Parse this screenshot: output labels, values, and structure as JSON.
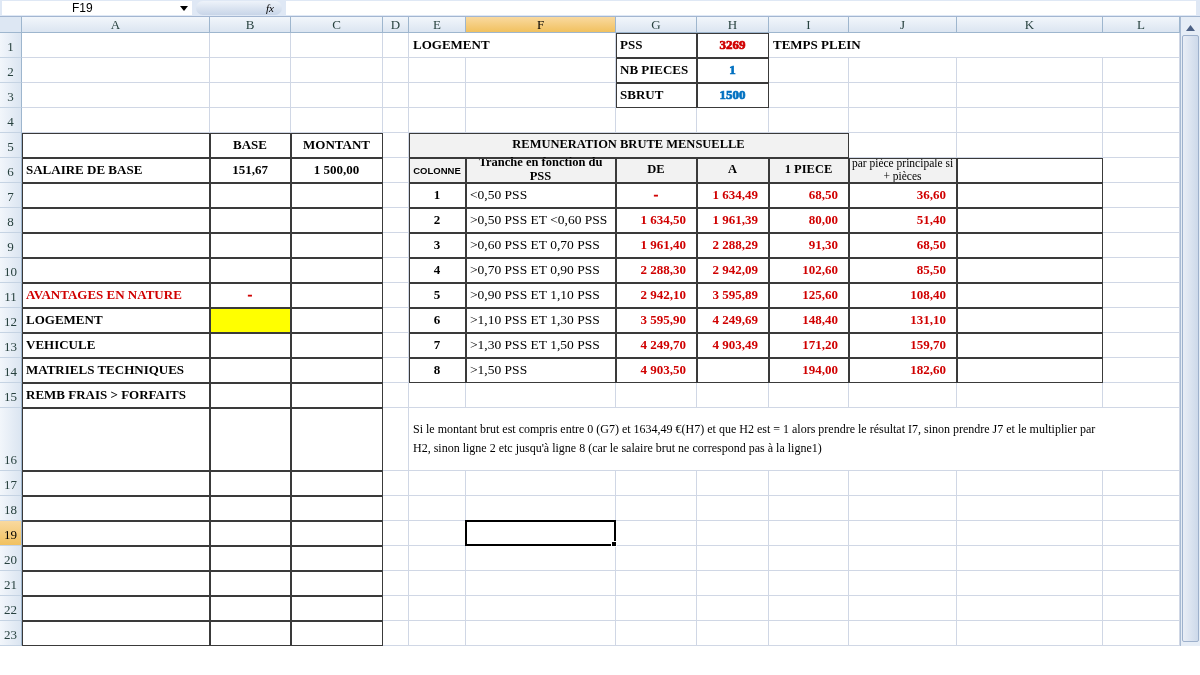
{
  "formula_bar": {
    "name_box": "F19",
    "function_label": "fx"
  },
  "columns": [
    {
      "label": "A",
      "selected": false
    },
    {
      "label": "B",
      "selected": false
    },
    {
      "label": "C",
      "selected": false
    },
    {
      "label": "D",
      "selected": false
    },
    {
      "label": "E",
      "selected": false
    },
    {
      "label": "F",
      "selected": true
    },
    {
      "label": "G",
      "selected": false
    },
    {
      "label": "H",
      "selected": false
    },
    {
      "label": "I",
      "selected": false
    },
    {
      "label": "J",
      "selected": false
    },
    {
      "label": "K",
      "selected": false
    },
    {
      "label": "L",
      "selected": false
    }
  ],
  "rows": [
    {
      "label": "1",
      "selected": false,
      "cells": {
        "E": {
          "kind": "label",
          "text": "LOGEMENT"
        },
        "G": {
          "kind": "label",
          "text": "PSS"
        },
        "H": {
          "kind": "center",
          "text": "3269",
          "color": "#d00000"
        },
        "I": {
          "kind": "label",
          "text": "TEMPS PLEIN"
        }
      }
    },
    {
      "label": "2",
      "selected": false,
      "cells": {
        "G": {
          "kind": "label",
          "text": "NB PIECES"
        },
        "H": {
          "kind": "center",
          "text": "1",
          "color": "#0070c0"
        }
      }
    },
    {
      "label": "3",
      "selected": false,
      "cells": {
        "G": {
          "kind": "label",
          "text": "SBRUT"
        },
        "H": {
          "kind": "center",
          "text": "1500",
          "color": "#0070c0"
        }
      }
    },
    {
      "label": "4",
      "selected": false,
      "cells": {}
    },
    {
      "label": "5",
      "selected": false,
      "cells": {
        "B": {
          "kind": "center",
          "text": "BASE"
        },
        "C": {
          "kind": "center",
          "text": "MONTANT"
        },
        "E": {
          "kind": "title",
          "text": "REMUNERATION BRUTE MENSUELLE"
        }
      }
    },
    {
      "label": "6",
      "selected": false,
      "cells": {
        "A": {
          "kind": "label",
          "text": "SALAIRE DE BASE"
        },
        "B": {
          "kind": "center",
          "text": "151,67"
        },
        "C": {
          "kind": "center",
          "text": "1 500,00"
        },
        "E": {
          "kind": "header-small",
          "text": "COLONNE"
        },
        "F": {
          "kind": "header",
          "text": "Tranche en fonction du PSS"
        },
        "G": {
          "kind": "header",
          "text": "DE"
        },
        "H": {
          "kind": "header",
          "text": "A"
        },
        "I": {
          "kind": "header",
          "text": "1 PIECE"
        },
        "J": {
          "kind": "header-plain",
          "text": "par pièce principale si + pièces"
        }
      }
    },
    {
      "label": "7",
      "selected": false,
      "cells": {
        "E": {
          "kind": "center",
          "text": "1"
        },
        "F": {
          "kind": "plain",
          "text": "<0,50 PSS"
        },
        "G": {
          "kind": "center",
          "text": "-",
          "color": "#d00000"
        },
        "H": {
          "kind": "right",
          "text": "1 634,49",
          "color": "#d00000"
        },
        "I": {
          "kind": "right",
          "text": "68,50",
          "color": "#d00000"
        },
        "J": {
          "kind": "right",
          "text": "36,60",
          "color": "#d00000"
        }
      }
    },
    {
      "label": "8",
      "selected": false,
      "cells": {
        "E": {
          "kind": "center",
          "text": "2"
        },
        "F": {
          "kind": "plain",
          "text": ">0,50 PSS ET <0,60 PSS"
        },
        "G": {
          "kind": "right",
          "text": "1 634,50",
          "color": "#d00000"
        },
        "H": {
          "kind": "right",
          "text": "1 961,39",
          "color": "#d00000"
        },
        "I": {
          "kind": "right",
          "text": "80,00",
          "color": "#d00000"
        },
        "J": {
          "kind": "right",
          "text": "51,40",
          "color": "#d00000"
        }
      }
    },
    {
      "label": "9",
      "selected": false,
      "cells": {
        "E": {
          "kind": "center",
          "text": "3"
        },
        "F": {
          "kind": "plain",
          "text": ">0,60 PSS ET 0,70 PSS"
        },
        "G": {
          "kind": "right",
          "text": "1 961,40",
          "color": "#d00000"
        },
        "H": {
          "kind": "right",
          "text": "2 288,29",
          "color": "#d00000"
        },
        "I": {
          "kind": "right",
          "text": "91,30",
          "color": "#d00000"
        },
        "J": {
          "kind": "right",
          "text": "68,50",
          "color": "#d00000"
        }
      }
    },
    {
      "label": "10",
      "selected": false,
      "cells": {
        "E": {
          "kind": "center",
          "text": "4"
        },
        "F": {
          "kind": "plain",
          "text": ">0,70 PSS ET 0,90 PSS"
        },
        "G": {
          "kind": "right",
          "text": "2 288,30",
          "color": "#d00000"
        },
        "H": {
          "kind": "right",
          "text": "2 942,09",
          "color": "#d00000"
        },
        "I": {
          "kind": "right",
          "text": "102,60",
          "color": "#d00000"
        },
        "J": {
          "kind": "right",
          "text": "85,50",
          "color": "#d00000"
        }
      }
    },
    {
      "label": "11",
      "selected": false,
      "cells": {
        "A": {
          "kind": "label",
          "text": "AVANTAGES EN NATURE",
          "color": "#d00000"
        },
        "B": {
          "kind": "center",
          "text": "-",
          "color": "#d00000"
        },
        "E": {
          "kind": "center",
          "text": "5"
        },
        "F": {
          "kind": "plain",
          "text": " >0,90 PSS ET 1,10 PSS"
        },
        "G": {
          "kind": "right",
          "text": "2 942,10",
          "color": "#d00000"
        },
        "H": {
          "kind": "right",
          "text": "3 595,89",
          "color": "#d00000"
        },
        "I": {
          "kind": "right",
          "text": "125,60",
          "color": "#d00000"
        },
        "J": {
          "kind": "right",
          "text": "108,40",
          "color": "#d00000"
        }
      }
    },
    {
      "label": "12",
      "selected": false,
      "cells": {
        "A": {
          "kind": "label",
          "text": "LOGEMENT"
        },
        "B": {
          "kind": "highlight"
        },
        "E": {
          "kind": "center",
          "text": "6"
        },
        "F": {
          "kind": "plain",
          "text": ">1,10 PSS ET 1,30 PSS"
        },
        "G": {
          "kind": "right",
          "text": "3 595,90",
          "color": "#d00000"
        },
        "H": {
          "kind": "right",
          "text": "4 249,69",
          "color": "#d00000"
        },
        "I": {
          "kind": "right",
          "text": "148,40",
          "color": "#d00000"
        },
        "J": {
          "kind": "right",
          "text": "131,10",
          "color": "#d00000"
        }
      }
    },
    {
      "label": "13",
      "selected": false,
      "cells": {
        "A": {
          "kind": "label",
          "text": "VEHICULE"
        },
        "E": {
          "kind": "center",
          "text": "7"
        },
        "F": {
          "kind": "plain",
          "text": ">1,30 PSS ET 1,50 PSS"
        },
        "G": {
          "kind": "right",
          "text": "4 249,70",
          "color": "#d00000"
        },
        "H": {
          "kind": "right",
          "text": "4 903,49",
          "color": "#d00000"
        },
        "I": {
          "kind": "right",
          "text": "171,20",
          "color": "#d00000"
        },
        "J": {
          "kind": "right",
          "text": "159,70",
          "color": "#d00000"
        }
      }
    },
    {
      "label": "14",
      "selected": false,
      "cells": {
        "A": {
          "kind": "label",
          "text": "MATRIELS TECHNIQUES"
        },
        "E": {
          "kind": "center",
          "text": "8"
        },
        "F": {
          "kind": "plain",
          "text": ">1,50 PSS"
        },
        "G": {
          "kind": "right",
          "text": "4 903,50",
          "color": "#d00000"
        },
        "I": {
          "kind": "right",
          "text": "194,00",
          "color": "#d00000"
        },
        "J": {
          "kind": "right",
          "text": "182,60",
          "color": "#d00000"
        }
      }
    },
    {
      "label": "15",
      "selected": false,
      "cells": {
        "A": {
          "kind": "label",
          "text": "REMB FRAIS > FORFAITS"
        }
      }
    },
    {
      "label": "16",
      "selected": false,
      "cells": {
        "E": {
          "kind": "note",
          "text": "Si le montant brut est compris entre 0 (G7) et 1634,49 €(H7)  et que H2 est = 1 alors prendre le résultat I7, sinon prendre J7 et le multiplier par H2, sinon ligne 2 etc jusqu'à ligne 8 (car le salaire brut ne correspond pas à la ligne1)"
        }
      }
    },
    {
      "label": "17",
      "selected": false,
      "cells": {}
    },
    {
      "label": "18",
      "selected": false,
      "cells": {}
    },
    {
      "label": "19",
      "selected": true,
      "cells": {
        "F": {
          "kind": "active"
        }
      }
    },
    {
      "label": "20",
      "selected": false,
      "cells": {}
    },
    {
      "label": "21",
      "selected": false,
      "cells": {}
    },
    {
      "label": "22",
      "selected": false,
      "cells": {}
    },
    {
      "label": "23",
      "selected": false,
      "cells": {}
    }
  ]
}
